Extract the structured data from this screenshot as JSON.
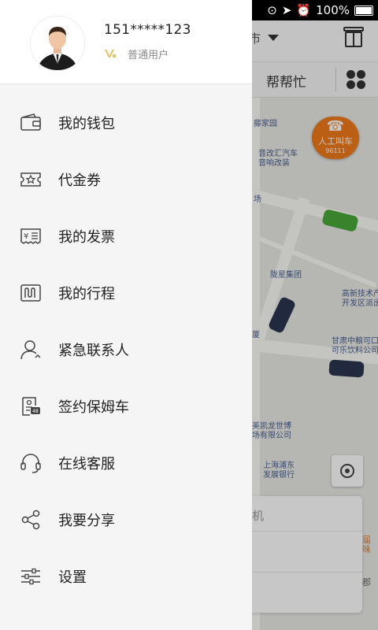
{
  "status_bar": {
    "battery_text": "100%"
  },
  "map": {
    "city_label": "市",
    "tab_label": "帮帮忙",
    "call_badge": {
      "line1": "人工叫车",
      "line2": "96111"
    },
    "labels": [
      "藤家园",
      "音改汇汽车\n音响改装",
      "场",
      "陇星集团",
      "高新技术产\n开发区派出",
      "甘肃中粮可口\n可乐饮料公司",
      "厦",
      "美凯龙世博\n场有限公司",
      "上海浦东\n发展银行",
      "届味",
      "郡"
    ],
    "card_text": "机"
  },
  "profile": {
    "phone": "151*****123",
    "user_type": "普通用户"
  },
  "menu": [
    {
      "label": "我的钱包",
      "icon": "wallet-icon"
    },
    {
      "label": "代金券",
      "icon": "coupon-icon"
    },
    {
      "label": "我的发票",
      "icon": "invoice-icon"
    },
    {
      "label": "我的行程",
      "icon": "trip-icon"
    },
    {
      "label": "紧急联系人",
      "icon": "emergency-contact-icon"
    },
    {
      "label": "签约保姆车",
      "icon": "contract-car-icon"
    },
    {
      "label": "在线客服",
      "icon": "headset-icon"
    },
    {
      "label": "我要分享",
      "icon": "share-icon"
    },
    {
      "label": "设置",
      "icon": "settings-icon"
    }
  ]
}
